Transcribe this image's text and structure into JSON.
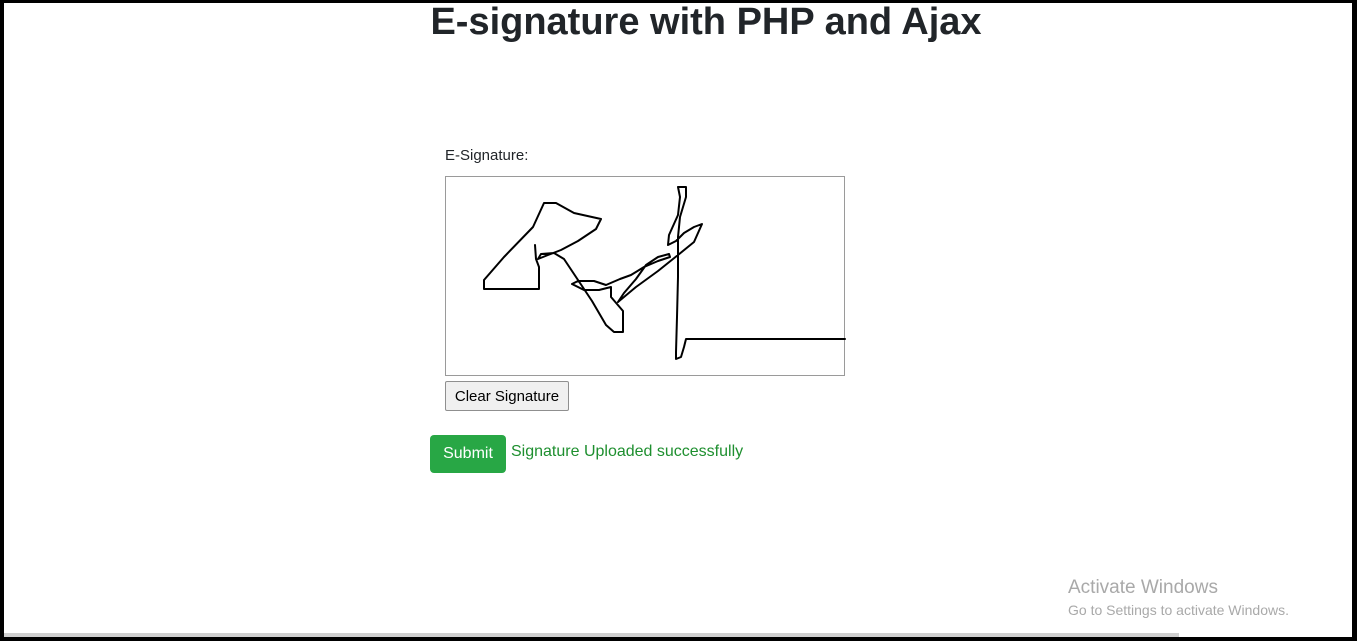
{
  "page": {
    "title": "E-signature with PHP and Ajax"
  },
  "form": {
    "signature_label": "E-Signature:",
    "clear_button_label": "Clear Signature",
    "submit_button_label": "Submit",
    "status_message": "Signature Uploaded successfully"
  },
  "colors": {
    "submit_button": "#28a745",
    "status_message": "#1e8f2f",
    "title": "#212529"
  },
  "watermark": {
    "title": "Activate Windows",
    "subtitle": "Go to Settings to activate Windows."
  }
}
